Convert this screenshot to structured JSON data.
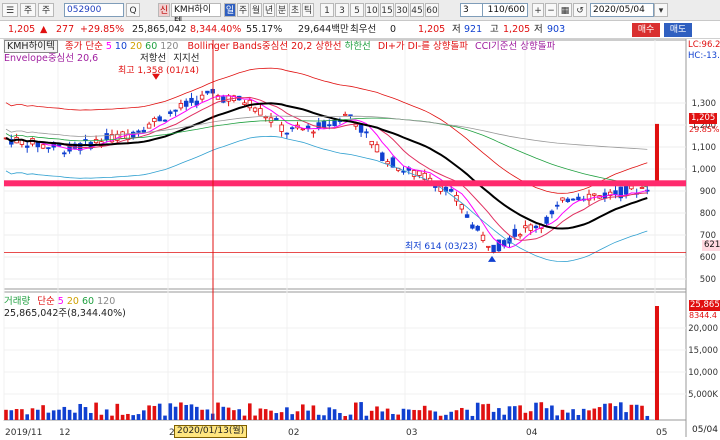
{
  "toolbar": {
    "menu_icon_glyph": "☰",
    "tab_jusik": "주",
    "tab_hyeon": "주",
    "code_value": "052900",
    "search_glyph": "Q",
    "stock_tag": "신",
    "stock_name": "KMH하이텍",
    "periods": [
      "일",
      "주",
      "월",
      "년",
      "분",
      "초",
      "틱"
    ],
    "intervals": [
      "1",
      "3",
      "5",
      "10",
      "15",
      "30",
      "45",
      "60"
    ],
    "interval_select": "3",
    "count_value": "110/600",
    "date_value": "2020/05/04",
    "active_period": "일"
  },
  "quote": {
    "price": "1,205",
    "price_arrow": "▲",
    "change": "277",
    "change_pct": "+29.85%",
    "volume": "25,865,042",
    "volume_ratio": "8,344.40%",
    "turnover": "55.17%",
    "amount": "29,644백만",
    "best_bid_label": "최우선",
    "best_bid_value": "0",
    "bid_price": "1,205",
    "low_label": "저",
    "low_value": "921",
    "high_label": "고",
    "high_value": "1,205",
    "high2_label": "저",
    "high2_value": "903",
    "buy_label": "매수",
    "sell_label": "매도"
  },
  "price_pane": {
    "legend_name": "KMH하이텍",
    "legend_ma": "종가 단순",
    "ma_periods": [
      "5",
      "10",
      "20",
      "60",
      "120"
    ],
    "legend_bb": "Bollinger Bands중심선 20,2",
    "legend_bb_up": "상한선",
    "legend_bb_dn": "하한선",
    "legend_dmi": "DI+가 DI-를 상향돌파",
    "legend_cci": "CCI기준선 상향돌파",
    "legend_env": "Envelope중심선 20,6",
    "legend_resist": "저항선",
    "legend_support": "지지선",
    "high_note": "최고 1,358 (01/14)",
    "low_note": "최저 614 (03/23)",
    "y_ticks": [
      "1,300",
      "1,200",
      "1,100",
      "1,000",
      "900",
      "800",
      "700",
      "600",
      "500"
    ],
    "top_right_lc": "LC:96.2",
    "top_right_hc": "HC:-13.",
    "last_price_tag": "1,205",
    "last_price_pct": "29.85%",
    "support_tag": "621",
    "colors": {
      "up": "#e01010",
      "down": "#1040d0",
      "ma5": "#ff00ff",
      "ma20": "#000000",
      "ma60": "#20a040",
      "support": "#ff2a6d"
    }
  },
  "volume_pane": {
    "legend_name": "거래량",
    "legend_ma": "단순",
    "ma_periods": [
      "5",
      "20",
      "60",
      "120"
    ],
    "value_line": "25,865,042주(8,344.40%)",
    "y_ticks": [
      "20,000",
      "15,000",
      "10,000",
      "5,000K"
    ],
    "right_tag": "25,865",
    "right_tag_pct": "8344.4"
  },
  "x_axis": {
    "labels": [
      "2019/11",
      "12",
      "2020",
      "02",
      "03",
      "04",
      "05"
    ],
    "cursor_label": "2020/01/13(월)",
    "right_date": "05/04"
  },
  "chart_data": {
    "type": "candlestick",
    "x": [
      "2019/11",
      "2019/12",
      "2020/01",
      "2020/02",
      "2020/03",
      "2020/04",
      "2020/05"
    ],
    "close_approx": [
      1120,
      1140,
      1330,
      1180,
      880,
      880,
      1205
    ],
    "y_range": [
      500,
      1350
    ],
    "markers": {
      "high": {
        "date": "01/14",
        "value": 1358
      },
      "low": {
        "date": "03/23",
        "value": 614
      }
    },
    "support": 621,
    "last": 1205
  }
}
